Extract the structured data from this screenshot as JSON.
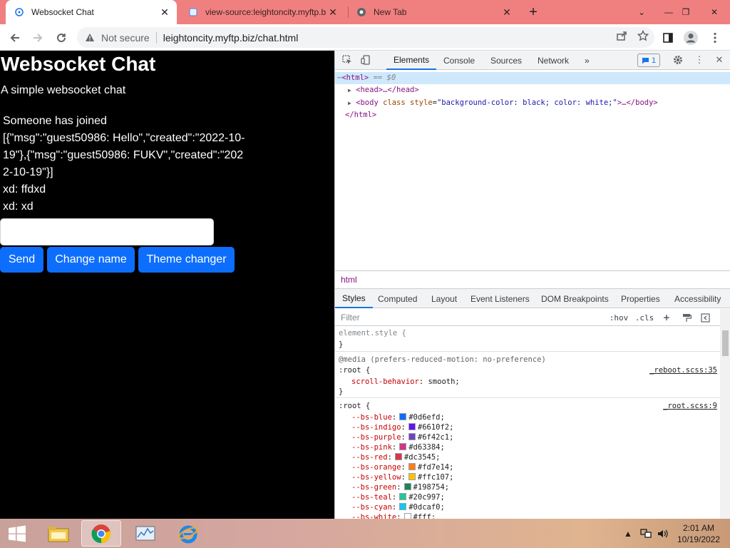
{
  "browser": {
    "tabs": [
      {
        "title": "Websocket Chat",
        "active": true
      },
      {
        "title": "view-source:leightoncity.myftp.b",
        "active": false
      },
      {
        "title": "New Tab",
        "active": false
      }
    ],
    "address": {
      "security_label": "Not secure",
      "url": "leightoncity.myftp.biz/chat.html"
    }
  },
  "page": {
    "title": "Websocket Chat",
    "subtitle": "A simple websocket chat",
    "messages": [
      "Someone has joined",
      "[{\"msg\":\"guest50986: Hello\",\"created\":\"2022-10-19\"},{\"msg\":\"guest50986: FUKV\",\"created\":\"2022-10-19\"}]",
      "xd: ffdxd",
      "xd: xd"
    ],
    "input_value": "",
    "buttons": {
      "send": "Send",
      "change_name": "Change name",
      "theme": "Theme changer"
    },
    "colors": {
      "background": "#000000",
      "text": "#ffffff",
      "button": "#0d6efd"
    }
  },
  "devtools": {
    "tabs": [
      "Elements",
      "Console",
      "Sources",
      "Network"
    ],
    "active_tab": "Elements",
    "more": "»",
    "issues_count": "1",
    "dom": {
      "html_open": "<html>",
      "html_eq": "== $0",
      "head": "<head>…</head>",
      "body_open_tag": "<body",
      "body_attr1": "class",
      "body_attr2": "style",
      "body_attr2_val": "\"background-color: black; color: white;\"",
      "body_rest": ">…</body>",
      "html_close": "</html>"
    },
    "breadcrumb": "html",
    "subtabs": [
      "Styles",
      "Computed",
      "Layout",
      "Event Listeners",
      "DOM Breakpoints",
      "Properties",
      "Accessibility"
    ],
    "filter_placeholder": "Filter",
    "filter_buttons": {
      "hov": ":hov",
      "cls": ".cls"
    },
    "styles": {
      "element_style": "element.style {",
      "close_brace": "}",
      "media": "@media (prefers-reduced-motion: no-preference)",
      "root_sel": ":root {",
      "reboot_src": "_reboot.scss:35",
      "scroll_prop": "scroll-behavior",
      "scroll_val": "smooth;",
      "root_src": "_root.scss:9",
      "vars": [
        {
          "name": "--bs-blue",
          "value": "#0d6efd;",
          "color": "#0d6efd"
        },
        {
          "name": "--bs-indigo",
          "value": "#6610f2;",
          "color": "#6610f2"
        },
        {
          "name": "--bs-purple",
          "value": "#6f42c1;",
          "color": "#6f42c1"
        },
        {
          "name": "--bs-pink",
          "value": "#d63384;",
          "color": "#d63384"
        },
        {
          "name": "--bs-red",
          "value": "#dc3545;",
          "color": "#dc3545"
        },
        {
          "name": "--bs-orange",
          "value": "#fd7e14;",
          "color": "#fd7e14"
        },
        {
          "name": "--bs-yellow",
          "value": "#ffc107;",
          "color": "#ffc107"
        },
        {
          "name": "--bs-green",
          "value": "#198754;",
          "color": "#198754"
        },
        {
          "name": "--bs-teal",
          "value": "#20c997;",
          "color": "#20c997"
        },
        {
          "name": "--bs-cyan",
          "value": "#0dcaf0;",
          "color": "#0dcaf0"
        },
        {
          "name": "--bs-white",
          "value": "#fff;",
          "color": "#ffffff"
        }
      ]
    }
  },
  "taskbar": {
    "time": "2:01 AM",
    "date": "10/19/2022"
  }
}
